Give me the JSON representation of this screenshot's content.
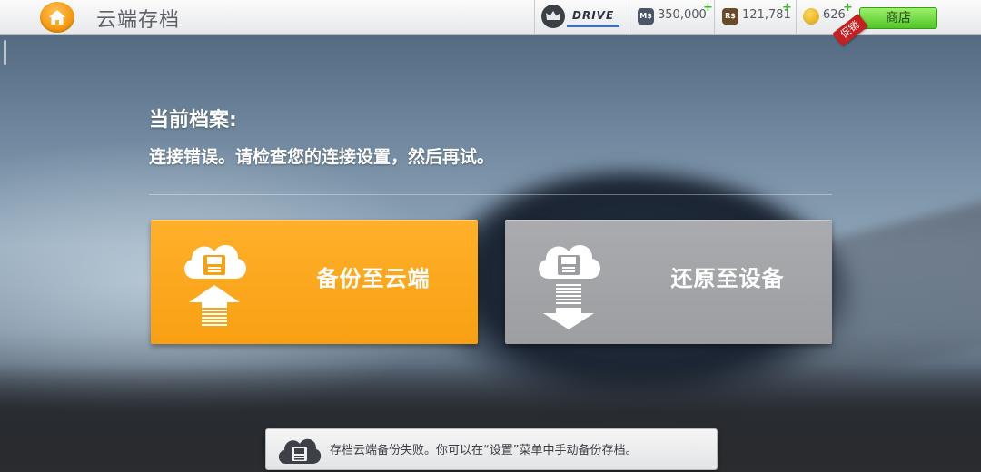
{
  "header": {
    "title": "云端存档",
    "drive_label": "DRIVE",
    "currencies": [
      {
        "icon": "ms-currency-icon",
        "abbr": "M$",
        "value": "350,000",
        "color": "#4a5568"
      },
      {
        "icon": "rs-currency-icon",
        "abbr": "R$",
        "value": "121,781",
        "color": "#6b4a2a"
      },
      {
        "icon": "gold-coin-icon",
        "abbr": "",
        "value": "626",
        "color": "#d99b12"
      }
    ],
    "plus_symbol": "+",
    "shop_label": "商店",
    "promo_label": "促销"
  },
  "main": {
    "profile_label": "当前档案:",
    "status_message": "连接错误。请检查您的连接设置，然后再试。",
    "backup_button": {
      "label": "备份至云端",
      "icon": "cloud-upload-icon",
      "color": "#f8a013"
    },
    "restore_button": {
      "label": "还原至设备",
      "icon": "cloud-download-icon",
      "color": "#9c9ea1"
    }
  },
  "toast": {
    "icon": "cloud-save-icon",
    "message": "存档云端备份失败。你可以在“设置”菜单中手动备份存档。"
  }
}
